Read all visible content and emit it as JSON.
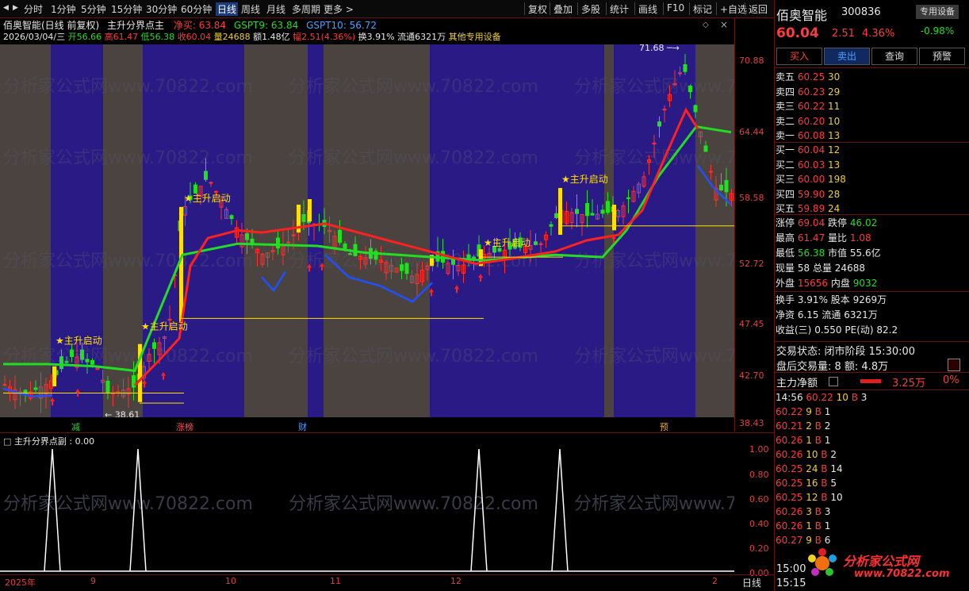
{
  "toolbar": {
    "nav_icons": [
      "◀",
      "▶"
    ],
    "periods": [
      "分时",
      "1分钟",
      "5分钟",
      "15分钟",
      "30分钟",
      "60分钟",
      "日线",
      "周线",
      "月线",
      "多周期",
      "更多 >"
    ],
    "active_period": "日线",
    "right_items": [
      "复权",
      "叠加",
      "多股",
      "统计",
      "画线",
      "F10",
      "标记",
      "+自选",
      "返回"
    ]
  },
  "main_header": {
    "stock": "佰奥智能(日线 前复权)",
    "indicator": "主升分界点主",
    "net_buy_label": "净买: 63.84",
    "gspt9": "GSPT9: 63.84",
    "gspt10": "GSPT10: 56.72",
    "date": "2026/03/04/三",
    "open": "开56.66",
    "high": "高61.47",
    "low": "低56.38",
    "close": "收60.04",
    "volume": "量24688",
    "amount": "额1.48亿",
    "amplitude": "幅2.51(4.36%)",
    "turnover": "换3.91%",
    "float_shares": "流通6321万",
    "category": "其他专用设备"
  },
  "main_chart": {
    "y_ticks": [
      "70.88",
      "64.44",
      "58.58",
      "52.72",
      "47.45",
      "42.70",
      "38.43"
    ],
    "max_label": "71.68",
    "min_label": "38.61",
    "signal_label": "主升启动",
    "bottom_tags": [
      "减",
      "涨榜",
      "财",
      "预"
    ],
    "watermark": "分析家公式网www.70822.com"
  },
  "sub_header": {
    "title": "主升分界点副 : 0.00"
  },
  "sub_chart": {
    "y_ticks": [
      "1.00",
      "0.80",
      "0.60",
      "0.40",
      "0.20",
      "0.00"
    ]
  },
  "x_axis": {
    "labels": [
      "2025年",
      "9",
      "10",
      "11",
      "12",
      "2"
    ],
    "period": "日线"
  },
  "quote": {
    "name": "佰奥智能",
    "code": "300836",
    "sector_tag": "专用设备",
    "sector_change": "-0.98%",
    "price": "60.04",
    "change": "2.51",
    "change_pct": "4.36%",
    "buttons": [
      "买入",
      "卖出",
      "查询",
      "预警"
    ],
    "asks": [
      {
        "label": "卖五",
        "price": "60.25",
        "vol": "30"
      },
      {
        "label": "卖四",
        "price": "60.23",
        "vol": "29"
      },
      {
        "label": "卖三",
        "price": "60.22",
        "vol": "11"
      },
      {
        "label": "卖二",
        "price": "60.20",
        "vol": "10"
      },
      {
        "label": "卖一",
        "price": "60.08",
        "vol": "13"
      }
    ],
    "bids": [
      {
        "label": "买一",
        "price": "60.04",
        "vol": "12"
      },
      {
        "label": "买二",
        "price": "60.03",
        "vol": "13"
      },
      {
        "label": "买三",
        "price": "60.00",
        "vol": "198"
      },
      {
        "label": "买四",
        "price": "59.90",
        "vol": "28"
      },
      {
        "label": "买五",
        "price": "59.89",
        "vol": "24"
      }
    ],
    "stats": [
      {
        "l1": "涨停",
        "v1": "69.04",
        "l2": "跌停",
        "v2": "46.02"
      },
      {
        "l1": "最高",
        "v1": "61.47",
        "l2": "量比",
        "v2": "1.08"
      },
      {
        "l1": "最低",
        "v1": "56.38",
        "l2": "市值",
        "v2": "55.6亿"
      },
      {
        "l1": "现量",
        "v1": "58",
        "l2": "总量",
        "v2": "24688"
      },
      {
        "l1": "外盘",
        "v1": "15656",
        "l2": "内盘",
        "v2": "9032"
      }
    ],
    "stats2": [
      {
        "l1": "换手",
        "v1": "3.91%",
        "l2": "股本",
        "v2": "9269万"
      },
      {
        "l1": "净资",
        "v1": "6.15",
        "l2": "流通",
        "v2": "6321万"
      },
      {
        "l1": "收益(三)",
        "v1": "0.550",
        "l2": "PE(动)",
        "v2": "82.2"
      }
    ],
    "trade_status": "交易状态: 闭市阶段 15:30:00",
    "after_hours": "盘后交易量: 8  额: 4.8万",
    "net_main_label": "主力净额",
    "net_main_value": "3.25万",
    "net_main_pct": "0%",
    "ticks": [
      {
        "time": "14:56",
        "price": "60.22",
        "vol": "10",
        "side": "B",
        "n": "3"
      },
      {
        "time": "",
        "price": "60.22",
        "vol": "9",
        "side": "B",
        "n": "1"
      },
      {
        "time": "",
        "price": "60.21",
        "vol": "2",
        "side": "B",
        "n": "2"
      },
      {
        "time": "",
        "price": "60.26",
        "vol": "1",
        "side": "B",
        "n": "1"
      },
      {
        "time": "",
        "price": "60.26",
        "vol": "10",
        "side": "B",
        "n": "2"
      },
      {
        "time": "",
        "price": "60.25",
        "vol": "24",
        "side": "B",
        "n": "14"
      },
      {
        "time": "",
        "price": "60.25",
        "vol": "16",
        "side": "B",
        "n": "5"
      },
      {
        "time": "",
        "price": "60.25",
        "vol": "12",
        "side": "B",
        "n": "10"
      },
      {
        "time": "",
        "price": "60.26",
        "vol": "3",
        "side": "B",
        "n": "3"
      },
      {
        "time": "",
        "price": "60.26",
        "vol": "1",
        "side": "B",
        "n": "1"
      },
      {
        "time": "",
        "price": "60.27",
        "vol": "9",
        "side": "B",
        "n": "6"
      }
    ],
    "bottom_times": [
      "15:00",
      "15:15"
    ],
    "logo_text": "分析家公式网",
    "logo_url_text": "www.70822.com"
  }
}
